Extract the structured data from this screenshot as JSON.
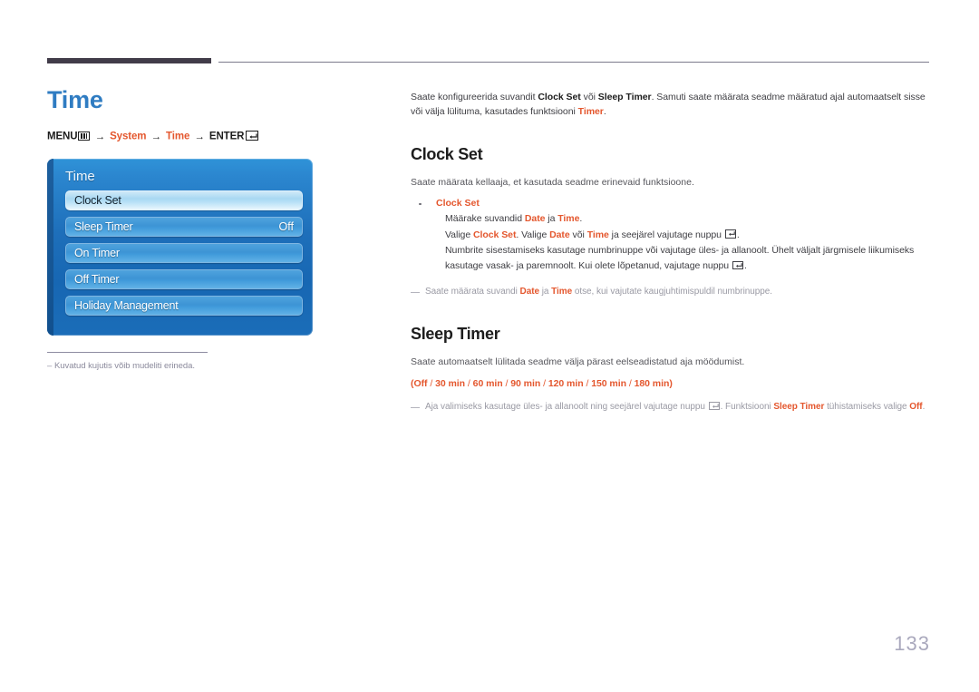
{
  "document": {
    "page_number": "133",
    "title": "Time"
  },
  "colors": {
    "title_blue": "#2f7cc2",
    "accent_orange": "#e4572e",
    "rule_dark": "#413c49",
    "note_gray": "#9a9aa4",
    "page_number": "#aaa9bd"
  },
  "menu_path": {
    "menu_label": "MENU",
    "menu_icon": "menu-grid-icon",
    "arrow": "→",
    "step_system": "System",
    "step_time": "Time",
    "enter_label": "ENTER",
    "enter_icon": "enter-return-icon"
  },
  "osd": {
    "title": "Time",
    "items": [
      {
        "label": "Clock Set",
        "value": "",
        "selected": true
      },
      {
        "label": "Sleep Timer",
        "value": "Off",
        "selected": false
      },
      {
        "label": "On Timer",
        "value": "",
        "selected": false
      },
      {
        "label": "Off Timer",
        "value": "",
        "selected": false
      },
      {
        "label": "Holiday Management",
        "value": "",
        "selected": false
      }
    ]
  },
  "left_footnote": {
    "dash": "‒",
    "text": "Kuvatud kujutis võib mudeliti erineda."
  },
  "intro": {
    "t1": "Saate konfigureerida suvandit ",
    "k1": "Clock Set",
    "t2": " või ",
    "k2": "Sleep Timer",
    "t3": ". Samuti saate määrata seadme määratud ajal automaatselt sisse või välja lülituma, kasutades funktsiooni ",
    "k3": "Timer",
    "t4": "."
  },
  "clock_set": {
    "heading": "Clock Set",
    "description": "Saate määrata kellaaja, et kasutada seadme erinevaid funktsioone.",
    "bullet_title": "Clock Set",
    "line1": {
      "t1": "Määrake suvandid ",
      "k1": "Date",
      "t2": " ja ",
      "k2": "Time",
      "t3": "."
    },
    "line2": {
      "t1": "Valige ",
      "k1": "Clock Set",
      "t2": ". Valige ",
      "k2": "Date",
      "t3": " või ",
      "k3": "Time",
      "t4": " ja seejärel vajutage nuppu ",
      "t5": "."
    },
    "line3": {
      "t1": "Numbrite sisestamiseks kasutage numbrinuppe või vajutage üles- ja allanoolt. Ühelt väljalt järgmisele liikumiseks kasutage vasak- ja paremnoolt. Kui olete lõpetanud, vajutage nuppu ",
      "t2": "."
    },
    "note": {
      "t1": "Saate määrata suvandi ",
      "k1": "Date",
      "t2": " ja ",
      "k2": "Time",
      "t3": " otse, kui vajutate kaugjuhtimispuldil numbrinuppe."
    }
  },
  "sleep_timer": {
    "heading": "Sleep Timer",
    "description": "Saate automaatselt lülitada seadme välja pärast eelseadistatud aja möödumist.",
    "options_open": "(",
    "options": [
      "Off",
      "30 min",
      "60 min",
      "90 min",
      "120 min",
      "150 min",
      "180 min"
    ],
    "options_sep": " / ",
    "options_close": ")",
    "note": {
      "t1": "Aja valimiseks kasutage üles- ja allanoolt ning seejärel vajutage nuppu ",
      "t2": ". Funktsiooni ",
      "k1": "Sleep Timer",
      "t3": " tühistamiseks valige ",
      "k2": "Off",
      "t4": "."
    }
  }
}
